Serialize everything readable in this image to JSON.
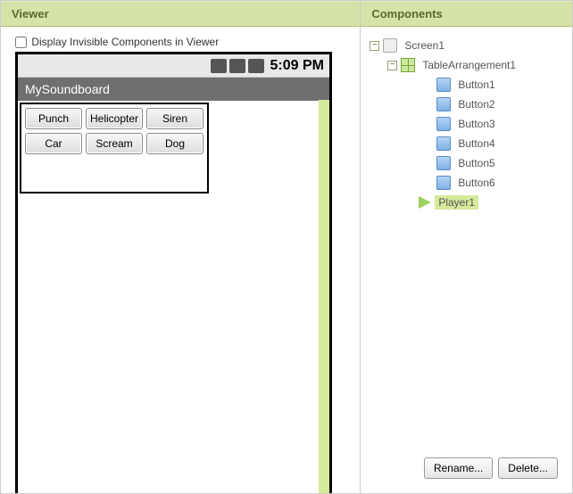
{
  "panels": {
    "viewer": "Viewer",
    "components": "Components"
  },
  "checkbox": {
    "label": "Display Invisible Components in Viewer"
  },
  "status": {
    "time": "5:09 PM"
  },
  "app": {
    "title": "MySoundboard",
    "buttons": [
      [
        "Punch",
        "Helicopter",
        "Siren"
      ],
      [
        "Car",
        "Scream",
        "Dog"
      ]
    ]
  },
  "tree": {
    "screen": "Screen1",
    "table": "TableArrangement1",
    "buttons": [
      "Button1",
      "Button2",
      "Button3",
      "Button4",
      "Button5",
      "Button6"
    ],
    "player": "Player1"
  },
  "actions": {
    "rename": "Rename...",
    "delete": "Delete..."
  },
  "toggle_minus": "−"
}
